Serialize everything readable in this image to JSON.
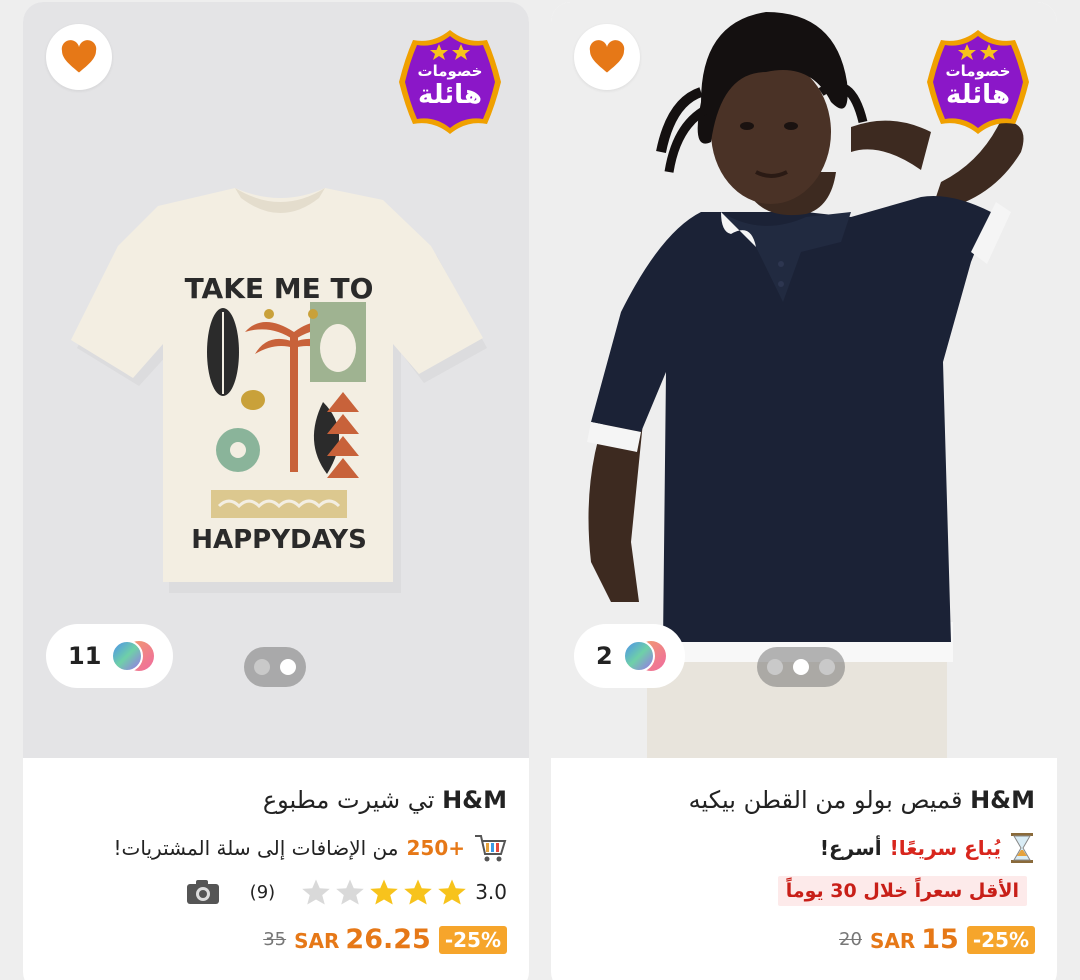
{
  "products": [
    {
      "brand": "H&M",
      "name": "تي شيرت مطبوع",
      "badge": {
        "top": "خصومات",
        "bottom": "هائلة"
      },
      "colors_count": "11",
      "carousel": {
        "total": 2,
        "active": 1
      },
      "shirt_print_top": "TAKE ME TO",
      "shirt_print_bottom": "HAPPYDAYS",
      "promo": {
        "count": "+250",
        "text": "من الإضافات إلى سلة المشتريات!"
      },
      "rating": "3.0",
      "stars_filled": 3,
      "stars_total": 5,
      "reviews": "(9)",
      "discount": "-25%",
      "currency": "SAR",
      "price": "26.25",
      "old_price": "35"
    },
    {
      "brand": "H&M",
      "name": "قميص بولو من القطن بيكيه",
      "badge": {
        "top": "خصومات",
        "bottom": "هائلة"
      },
      "colors_count": "2",
      "carousel": {
        "total": 3,
        "active": 1
      },
      "selling": {
        "hot": "يُباع سريعًا!",
        "hurry": "أسرع!"
      },
      "lowest_label": "الأقل سعراً خلال 30 يوماً",
      "discount": "-25%",
      "currency": "SAR",
      "price": "15",
      "old_price": "20"
    }
  ],
  "icons": {
    "heart": "heart-icon",
    "cart": "cart-icon",
    "hourglass": "hourglass-icon",
    "camera": "camera-icon",
    "color_swatch": "color-swatch-icon",
    "star": "star-icon"
  },
  "colors": {
    "accent_orange": "#e67817",
    "discount_bg": "#f6a52b",
    "badge_purple": "#8b17c8",
    "badge_gold": "#f0a000",
    "star_filled": "#f7c31c",
    "star_empty": "#d9d9d9",
    "hot_red": "#d8261d"
  }
}
